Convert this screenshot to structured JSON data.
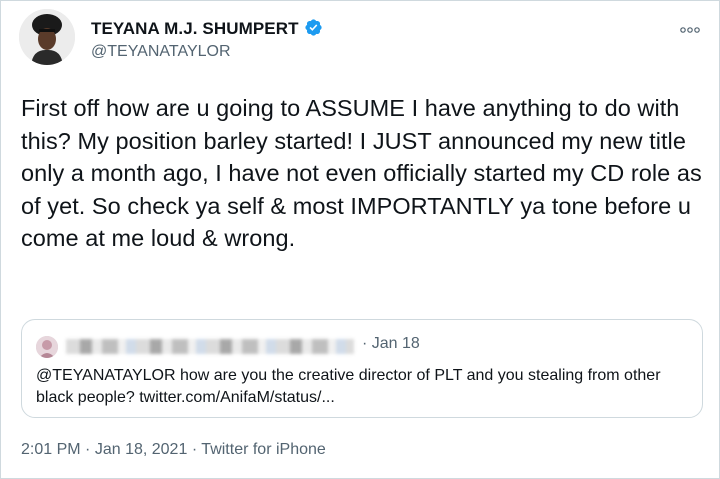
{
  "author": {
    "name": "TEYANA M.J. SHUMPERT",
    "handle": "@TEYANATAYLOR",
    "verified": true
  },
  "tweet": {
    "text": "First off how are u going to ASSUME I have anything to do with this? My position barley started! I JUST announced my new title only a month ago, I have not even officially started my CD role as of yet. So check ya self & most IMPORTANTLY ya tone before u come at me loud & wrong."
  },
  "quoted_tweet": {
    "date": "· Jan 18",
    "text": "@TEYANATAYLOR  how are you the creative director of PLT and you stealing from other black people? twitter.com/AnifaM/status/..."
  },
  "meta": {
    "time": "2:01 PM",
    "separator": "·",
    "date": "Jan 18, 2021",
    "source": "Twitter for iPhone"
  },
  "icons": {
    "verified": "verified-badge-icon",
    "more": "more-options-icon"
  },
  "colors": {
    "verified_blue": "#1d9bf0",
    "secondary_text": "#536471",
    "border": "#cfd9de"
  }
}
